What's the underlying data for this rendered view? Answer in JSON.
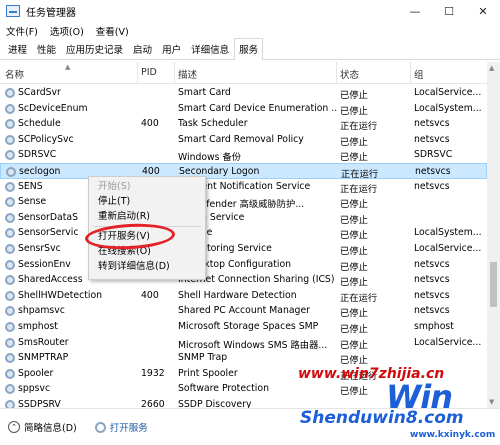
{
  "window": {
    "title": "任务管理器",
    "controls": [
      "—",
      "☐",
      "✕"
    ]
  },
  "menu": [
    "文件(F)",
    "选项(O)",
    "查看(V)"
  ],
  "tabs": [
    "进程",
    "性能",
    "应用历史记录",
    "启动",
    "用户",
    "详细信息",
    "服务"
  ],
  "active_tab": "服务",
  "columns": {
    "name": "名称",
    "pid": "PID",
    "desc": "描述",
    "status": "状态",
    "group": "组"
  },
  "rows": [
    {
      "name": "SCardSvr",
      "pid": "",
      "desc": "Smart Card",
      "status": "已停止",
      "group": "LocalService..."
    },
    {
      "name": "ScDeviceEnum",
      "pid": "",
      "desc": "Smart Card Device Enumeration ...",
      "status": "已停止",
      "group": "LocalSystem..."
    },
    {
      "name": "Schedule",
      "pid": "400",
      "desc": "Task Scheduler",
      "status": "正在运行",
      "group": "netsvcs"
    },
    {
      "name": "SCPolicySvc",
      "pid": "",
      "desc": "Smart Card Removal Policy",
      "status": "已停止",
      "group": "netsvcs"
    },
    {
      "name": "SDRSVC",
      "pid": "",
      "desc": "Windows 备份",
      "status": "已停止",
      "group": "SDRSVC"
    },
    {
      "name": "seclogon",
      "pid": "400",
      "desc": "Secondary Logon",
      "status": "正在运行",
      "group": "netsvcs"
    },
    {
      "name": "SENS",
      "pid": "",
      "desc": "m Event Notification Service",
      "status": "正在运行",
      "group": "netsvcs"
    },
    {
      "name": "Sense",
      "pid": "",
      "desc": "ws Defender 高级威胁防护...",
      "status": "已停止",
      "group": ""
    },
    {
      "name": "SensorDataS",
      "pid": "",
      "desc": "r Data Service",
      "status": "已停止",
      "group": ""
    },
    {
      "name": "SensorServic",
      "pid": "",
      "desc": "Service",
      "status": "已停止",
      "group": "LocalSystem..."
    },
    {
      "name": "SensrSvc",
      "pid": "",
      "desc": "r Monitoring Service",
      "status": "已停止",
      "group": "LocalService..."
    },
    {
      "name": "SessionEnv",
      "pid": "",
      "desc": "e Desktop Configuration",
      "status": "已停止",
      "group": "netsvcs"
    },
    {
      "name": "SharedAccess",
      "pid": "",
      "desc": "Internet Connection Sharing (ICS)",
      "status": "已停止",
      "group": "netsvcs"
    },
    {
      "name": "ShellHWDetection",
      "pid": "400",
      "desc": "Shell Hardware Detection",
      "status": "正在运行",
      "group": "netsvcs"
    },
    {
      "name": "shpamsvc",
      "pid": "",
      "desc": "Shared PC Account Manager",
      "status": "已停止",
      "group": "netsvcs"
    },
    {
      "name": "smphost",
      "pid": "",
      "desc": "Microsoft Storage Spaces SMP",
      "status": "已停止",
      "group": "smphost"
    },
    {
      "name": "SmsRouter",
      "pid": "",
      "desc": "Microsoft Windows SMS 路由器...",
      "status": "已停止",
      "group": "LocalService..."
    },
    {
      "name": "SNMPTRAP",
      "pid": "",
      "desc": "SNMP Trap",
      "status": "已停止",
      "group": ""
    },
    {
      "name": "Spooler",
      "pid": "1932",
      "desc": "Print Spooler",
      "status": "正在运行",
      "group": ""
    },
    {
      "name": "sppsvc",
      "pid": "",
      "desc": "Software Protection",
      "status": "已停止",
      "group": ""
    },
    {
      "name": "SSDPSRV",
      "pid": "2660",
      "desc": "SSDP Discovery",
      "status": "",
      "group": ""
    }
  ],
  "selected_row": 5,
  "context_menu": [
    {
      "label": "开始(S)",
      "disabled": true
    },
    {
      "label": "停止(T)",
      "disabled": false
    },
    {
      "label": "重新启动(R)",
      "disabled": false
    },
    {
      "sep": true
    },
    {
      "label": "打开服务(V)",
      "disabled": false
    },
    {
      "label": "在线搜索(O)",
      "disabled": false
    },
    {
      "label": "转到详细信息(D)",
      "disabled": false
    }
  ],
  "statusbar": {
    "less": "简略信息(D)",
    "open_services": "打开服务"
  },
  "watermark": {
    "top": "www.win7zhijia.cn",
    "logo": "Win",
    "sub": "Shenduwin8.com",
    "url2": "www.kxinyk.com"
  },
  "colors": {
    "selected_bg": "#cce8ff",
    "ring": "#e32127",
    "link": "#1a5aa6",
    "watermark_blue": "#1d5fd6",
    "watermark_red": "#d10b0b"
  }
}
